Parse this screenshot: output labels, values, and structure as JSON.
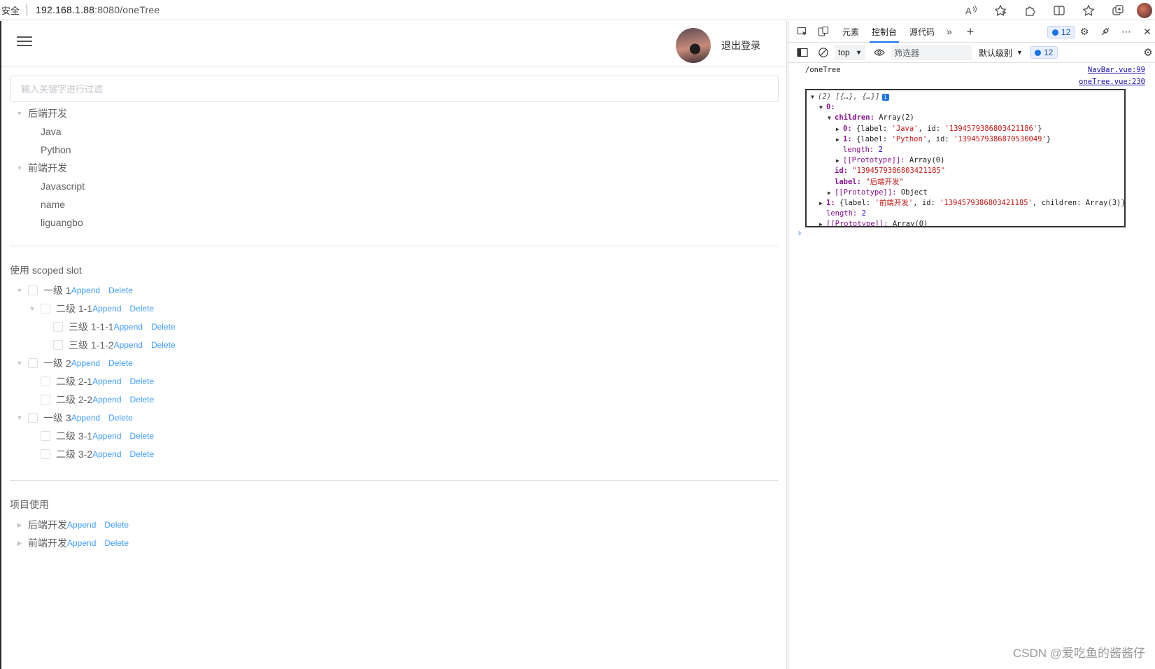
{
  "browser": {
    "security_label": "安全",
    "url_host": "192.168.1.88",
    "url_path": ":8080/oneTree",
    "icons": [
      "read-aloud-icon",
      "favorite-add-icon",
      "extensions-icon",
      "split-screen-icon",
      "favorites-icon",
      "collections-icon",
      "profile-avatar"
    ]
  },
  "navbar": {
    "logout_label": "退出登录"
  },
  "filter": {
    "placeholder": "输入关键字进行过滤"
  },
  "tree1": {
    "nodes": [
      {
        "label": "后端开发",
        "children": [
          "Java",
          "Python"
        ]
      },
      {
        "label": "前端开发",
        "children": [
          "Javascript",
          "name",
          "liguangbo"
        ]
      }
    ]
  },
  "scoped": {
    "title": "使用 scoped slot",
    "append_label": "Append",
    "delete_label": "Delete",
    "rows": [
      {
        "label": "一级 1"
      },
      {
        "label": "二级 1-1"
      },
      {
        "label": "三级 1-1-1"
      },
      {
        "label": "三级 1-1-2"
      },
      {
        "label": "一级 2"
      },
      {
        "label": "二级 2-1"
      },
      {
        "label": "二级 2-2"
      },
      {
        "label": "一级 3"
      },
      {
        "label": "二级 3-1"
      },
      {
        "label": "二级 3-2"
      }
    ]
  },
  "project": {
    "title": "项目使用",
    "rows": [
      {
        "label": "后端开发"
      },
      {
        "label": "前端开发"
      }
    ]
  },
  "devtools": {
    "tabs": [
      "元素",
      "控制台",
      "源代码"
    ],
    "active_tab": "控制台",
    "issue_count": "12",
    "context": "top",
    "filter_placeholder": "筛选器",
    "level": "默认级别",
    "log1_text": "/oneTree",
    "log1_src": "NavBar.vue:99",
    "log2_src": "oneTree.vue:230",
    "object_lines": {
      "l0": "(2) [{…}, {…}]",
      "l1_key": "0:",
      "l2_key": "children:",
      "l2_val": "Array(2)",
      "l3_key": "0:",
      "l3_pre": "{label: ",
      "l3_label": "'Java'",
      "l3_mid": ", id: ",
      "l3_id": "'1394579386803421186'",
      "l3_end": "}",
      "l4_key": "1:",
      "l4_pre": "{label: ",
      "l4_label": "'Python'",
      "l4_mid": ", id: ",
      "l4_id": "'1394579386870530049'",
      "l4_end": "}",
      "l5_key": "length:",
      "l5_val": "2",
      "l6_key": "[[Prototype]]:",
      "l6_val": "Array(0)",
      "l7_key": "id:",
      "l7_val": "\"1394579386803421185\"",
      "l8_key": "label:",
      "l8_val": "\"后端开发\"",
      "l9_key": "[[Prototype]]:",
      "l9_val": "Object",
      "l10_key": "1:",
      "l10_pre": "{label: ",
      "l10_label": "'前端开发'",
      "l10_mid": ", id: ",
      "l10_id": "'1394579386803421185'",
      "l10_end": ", children: Array(3)}",
      "l11_key": "length:",
      "l11_val": "2",
      "l12_key": "[[Prototype]]:",
      "l12_val": "Array(0)"
    }
  },
  "watermark": "CSDN @爱吃鱼的酱酱仔"
}
